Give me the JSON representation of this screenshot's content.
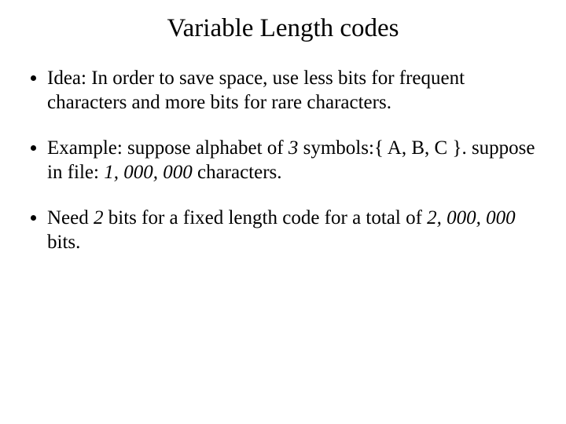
{
  "title": "Variable Length codes",
  "bullets": [
    {
      "line1": "Idea: In order to save space, use less bits for frequent characters and more bits for rare characters."
    },
    {
      "prefix": "Example: suppose alphabet of ",
      "italic1": "3",
      "mid1": " symbols:{ A, B, C }. suppose in file: ",
      "italic2": "1, 000, 000",
      "suffix": " characters."
    },
    {
      "prefix": "Need ",
      "italic1": "2",
      "mid1": " bits for a fixed length code for a total of ",
      "italic2": "2, 000, 000",
      "suffix": " bits."
    }
  ]
}
